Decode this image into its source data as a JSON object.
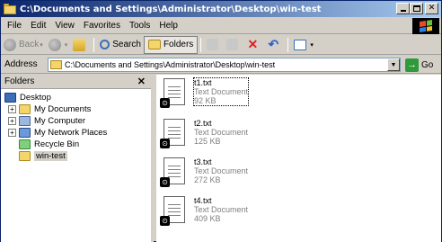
{
  "window": {
    "title": "C:\\Documents and Settings\\Administrator\\Desktop\\win-test"
  },
  "menu": {
    "items": [
      "File",
      "Edit",
      "View",
      "Favorites",
      "Tools",
      "Help"
    ]
  },
  "toolbar": {
    "back": "Back",
    "search": "Search",
    "folders": "Folders"
  },
  "address": {
    "label": "Address",
    "value": "C:\\Documents and Settings\\Administrator\\Desktop\\win-test",
    "go": "Go"
  },
  "folders_pane": {
    "title": "Folders",
    "close": "✕",
    "tree": [
      {
        "label": "Desktop",
        "icon": "desktop-icon",
        "level": 0,
        "expander": ""
      },
      {
        "label": "My Documents",
        "icon": "folder-icon",
        "level": 1,
        "expander": "+"
      },
      {
        "label": "My Computer",
        "icon": "computer-icon",
        "level": 1,
        "expander": "+"
      },
      {
        "label": "My Network Places",
        "icon": "network-icon",
        "level": 1,
        "expander": "+"
      },
      {
        "label": "Recycle Bin",
        "icon": "recycle-bin-icon",
        "level": 1,
        "expander": ""
      },
      {
        "label": "win-test",
        "icon": "folder-icon",
        "level": 1,
        "expander": "",
        "selected": true
      }
    ]
  },
  "files": [
    {
      "name": "t1.txt",
      "type": "Text Document",
      "size": "92 KB",
      "focused": true
    },
    {
      "name": "t2.txt",
      "type": "Text Document",
      "size": "125 KB"
    },
    {
      "name": "t3.txt",
      "type": "Text Document",
      "size": "272 KB"
    },
    {
      "name": "t4.txt",
      "type": "Text Document",
      "size": "409 KB"
    }
  ],
  "colors": {
    "titlebar_start": "#0a246a",
    "titlebar_end": "#a6caf0",
    "chrome": "#d4d0c8"
  }
}
